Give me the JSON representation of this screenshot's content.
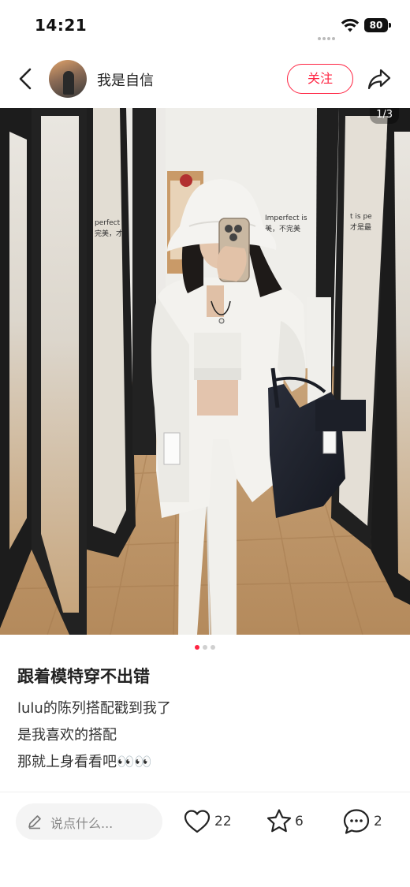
{
  "status_bar": {
    "time": "14:21",
    "battery": "80"
  },
  "header": {
    "username": "我是自信",
    "follow_label": "关注"
  },
  "photo": {
    "page_counter": "1/3",
    "current_index": 1,
    "total": 3,
    "sign_text_1": "perfect",
    "sign_text_2": "完美，才",
    "sign_text_3": "Imperfect is",
    "sign_text_4": "美，不完美",
    "sign_text_5": "t is pe",
    "sign_text_6": "才是最"
  },
  "post": {
    "title": "跟着模特穿不出错",
    "lines": [
      "lulu的陈列搭配戳到我了",
      "是我喜欢的搭配",
      "那就上身看看吧👀👀"
    ]
  },
  "bottom_bar": {
    "comment_placeholder": "说点什么...",
    "like_count": "22",
    "collect_count": "6",
    "comment_count": "2"
  },
  "colors": {
    "accent": "#ff2442",
    "text": "#222222",
    "muted": "#888888"
  }
}
